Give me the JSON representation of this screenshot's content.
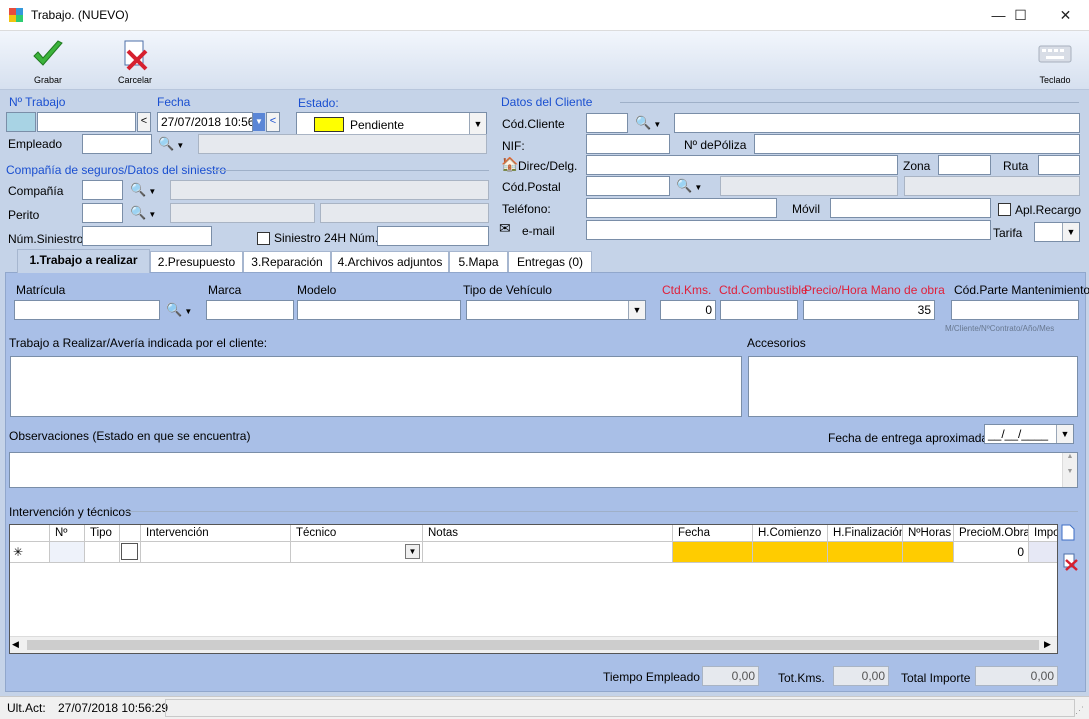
{
  "window": {
    "title": "Trabajo. (NUEVO)",
    "btn_min": "—",
    "btn_max": "☐",
    "btn_close": "✕"
  },
  "toolbar": {
    "save_label": "Grabar",
    "cancel_label": "Carcelar",
    "keyboard_label": "Teclado"
  },
  "job": {
    "no_label": "Nº Trabajo",
    "no_value": "",
    "lt": "<",
    "date_label": "Fecha",
    "date_value": "27/07/2018 10:56",
    "status_label": "Estado:",
    "status_value": "Pendiente",
    "status_color": "#ffff00",
    "employee_label": "Empleado",
    "employee_value": ""
  },
  "insurance": {
    "section_label": "Compañía de seguros/Datos del siniestro",
    "company_label": "Compañía",
    "expert_label": "Perito",
    "claim_label": "Núm.Siniestro",
    "claim24_label": "Siniestro 24H Núm."
  },
  "client": {
    "section_label": "Datos del Cliente",
    "code_label": "Cód.Cliente",
    "nif_label": "NIF:",
    "policy_label": "Nº dePóliza",
    "address_label": "Direc/Delg.",
    "zone_label": "Zona",
    "route_label": "Ruta",
    "postal_label": "Cód.Postal",
    "phone_label": "Teléfono:",
    "mobile_label": "Móvil",
    "surcharge_label": "Apl.Recargo",
    "email_label": "e-mail",
    "rate_label": "Tarifa"
  },
  "tabs": [
    {
      "label": "1.Trabajo a realizar"
    },
    {
      "label": "2.Presupuesto"
    },
    {
      "label": "3.Reparación"
    },
    {
      "label": "4.Archivos adjuntos"
    },
    {
      "label": "5.Mapa"
    },
    {
      "label": "Entregas (0)"
    }
  ],
  "vehicle": {
    "plate_label": "Matrícula",
    "brand_label": "Marca",
    "model_label": "Modelo",
    "type_label": "Tipo de Vehículo",
    "kms_label": "Ctd.Kms.",
    "kms_value": "0",
    "fuel_label": "Ctd.Combustible",
    "rate_label": "Precio/Hora Mano de obra",
    "rate_value": "35",
    "maint_label": "Cód.Parte Mantenimiento",
    "maint_hint": "M/Cliente/NºContrato/Año/Mes"
  },
  "work": {
    "task_label": "Trabajo a Realizar/Avería indicada por el cliente:",
    "accessories_label": "Accesorios",
    "observations_label": "Observaciones (Estado en que se encuentra)",
    "delivery_label": "Fecha de entrega aproximada:",
    "delivery_value": "__/__/____"
  },
  "interventions": {
    "section_label": "Intervención y técnicos",
    "headers": [
      "Nº",
      "Tipo",
      "Intervención",
      "Técnico",
      "Notas",
      "Fecha",
      "H.Comienzo",
      "H.Finalización",
      "NºHoras",
      "PrecioM.Obra",
      "Impo"
    ],
    "new_row_marker": "✳",
    "price_value": "0",
    "highlight_color": "#ffcc00"
  },
  "totals": {
    "time_label": "Tiempo Empleado",
    "time_value": "0,00",
    "kms_label": "Tot.Kms.",
    "kms_value": "0,00",
    "amount_label": "Total Importe",
    "amount_value": "0,00"
  },
  "status": {
    "last_label": "Ult.Act:",
    "last_value": "27/07/2018 10:56:29"
  }
}
